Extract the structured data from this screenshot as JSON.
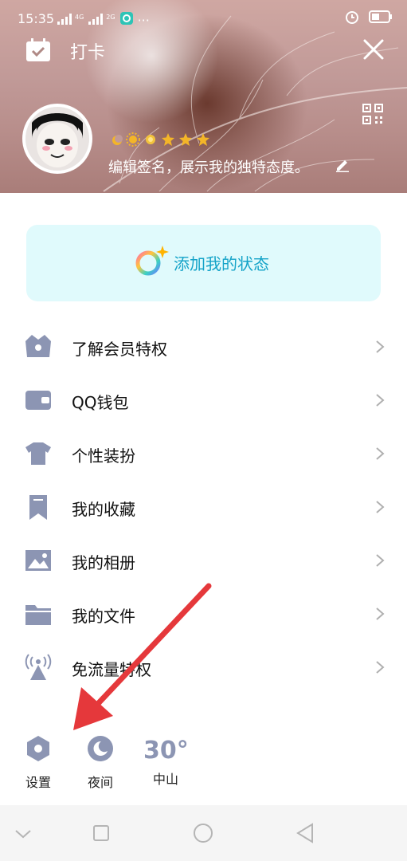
{
  "status_bar": {
    "time": "15:35",
    "net1": "4G",
    "net2": "2G",
    "more": "···"
  },
  "topbar": {
    "title": "打卡"
  },
  "profile": {
    "signature": "编辑签名，展示我的独特态度。"
  },
  "status_card": {
    "label": "添加我的状态"
  },
  "menu": {
    "items": [
      {
        "label": "了解会员特权",
        "icon": "crown-basket-icon"
      },
      {
        "label": "QQ钱包",
        "icon": "wallet-icon"
      },
      {
        "label": "个性装扮",
        "icon": "tshirt-icon"
      },
      {
        "label": "我的收藏",
        "icon": "bookmark-icon"
      },
      {
        "label": "我的相册",
        "icon": "photo-album-icon"
      },
      {
        "label": "我的文件",
        "icon": "folder-icon"
      },
      {
        "label": "免流量特权",
        "icon": "signal-tower-icon"
      }
    ]
  },
  "bottom": {
    "settings_label": "设置",
    "night_label": "夜间",
    "temperature": "30°",
    "city": "中山"
  },
  "colors": {
    "status_text": "#14a3c8",
    "icon_gray": "#8c95b3",
    "arrow_red": "#e5383b"
  }
}
